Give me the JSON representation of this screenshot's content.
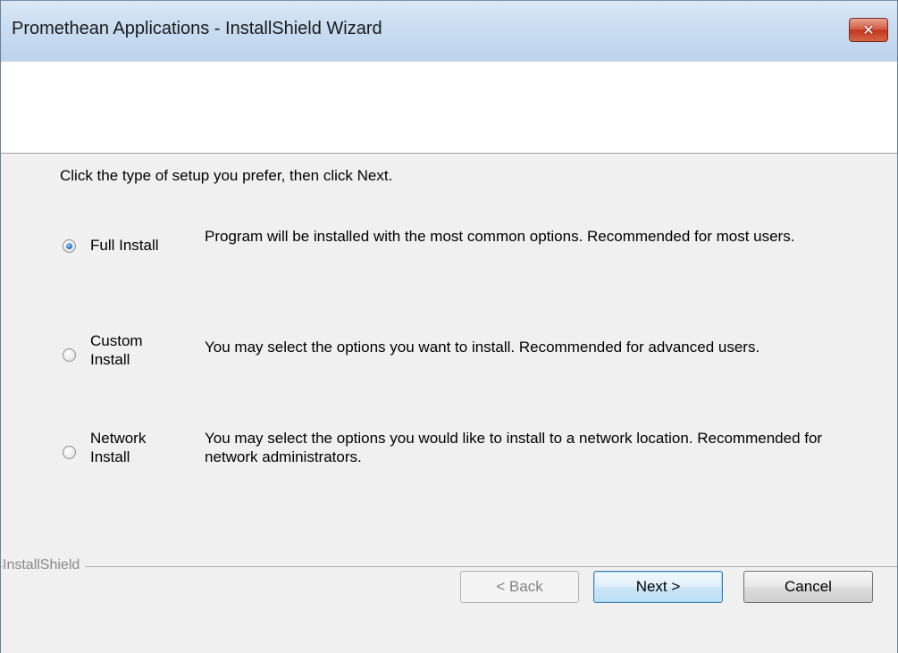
{
  "window": {
    "title": "Promethean Applications - InstallShield Wizard",
    "close_glyph": "✕"
  },
  "instruction": "Click the type of setup you prefer, then click Next.",
  "options": [
    {
      "label_line1": "Full Install",
      "label_line2": "",
      "description": "Program will be installed with the most common options.  Recommended for most users.",
      "selected": true
    },
    {
      "label_line1": "Custom",
      "label_line2": "Install",
      "description": "You may select the options you want to install. Recommended for advanced users.",
      "selected": false
    },
    {
      "label_line1": "Network",
      "label_line2": "Install",
      "description": "You may select the options you would like to install to a network location. Recommended for network administrators.",
      "selected": false
    }
  ],
  "branding": "InstallShield",
  "buttons": {
    "back": "< Back",
    "next": "Next >",
    "cancel": "Cancel"
  },
  "colors": {
    "selected_radio": "#2a7cc7",
    "close_button": "#c2351c"
  }
}
